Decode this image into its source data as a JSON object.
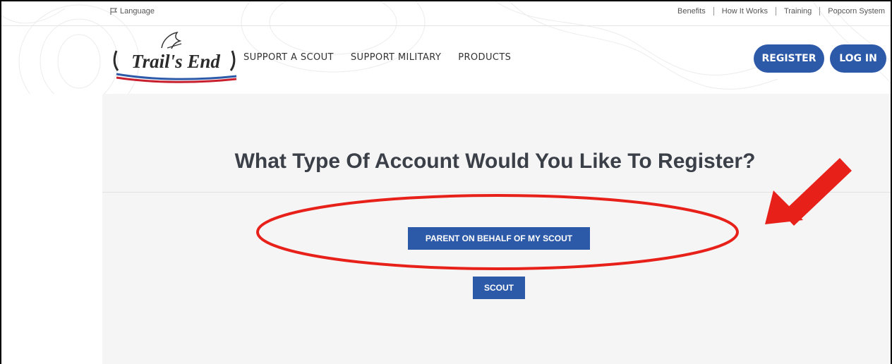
{
  "utility": {
    "language_label": "Language",
    "links": [
      "Benefits",
      "How It Works",
      "Training",
      "Popcorn System"
    ]
  },
  "logo": {
    "text": "Trail's End"
  },
  "nav": {
    "items": [
      "SUPPORT A SCOUT",
      "SUPPORT MILITARY",
      "PRODUCTS"
    ]
  },
  "auth": {
    "register_label": "REGISTER",
    "login_label": "LOG IN"
  },
  "main": {
    "heading": "What Type Of Account Would You Like To Register?",
    "options": [
      "PARENT ON BEHALF OF MY SCOUT",
      "SCOUT"
    ]
  },
  "colors": {
    "brand_blue": "#2d5aa8",
    "annotation_red": "#e8201a"
  }
}
